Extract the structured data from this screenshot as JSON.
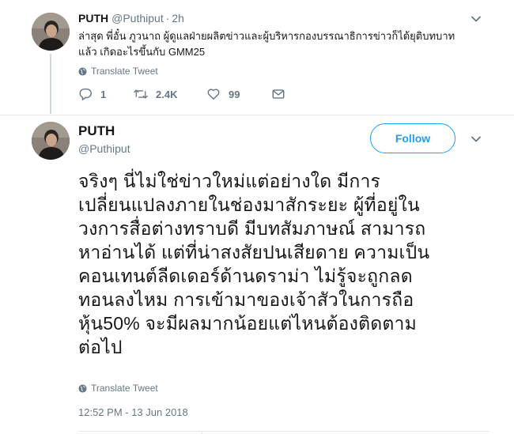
{
  "reply_tweet": {
    "name": "PUTH",
    "handle": "@Puthiput",
    "separator": "·",
    "time": "2h",
    "text_lines": [
      "ล่าสุด พี่อั๋น ภูวนาถ ผู้ดูแลฝ่ายผลิตข่าวและผู้บริหารกองบรรณาธิการข่าวก็ได้ยุติบทบาท",
      "แล้ว เกิดอะไรขึ้นกับ GMM25"
    ],
    "translate_label": "Translate Tweet",
    "reply_count": "1",
    "retweet_count": "2.4K",
    "like_count": "99"
  },
  "main_tweet": {
    "name": "PUTH",
    "handle": "@Puthiput",
    "follow_label": "Follow",
    "text_lines": [
      "จริงๆ นี่ไม่ใช่ข่าวใหม่แต่อย่างใด มีการ",
      "เปลี่ยนแปลงภายในช่องมาสักระยะ ผู้ที่อยู่ใน",
      "วงการสื่อต่างทราบดี มีบทสัมภาษณ์ สามารถ",
      "หาอ่านได้ แต่ที่น่าสงสัยปนเสียดาย ความเป็น",
      "คอนเทนต์ลีดเดอร์ด้านดราม่า ไม่รู้จะถูกลด",
      "ทอนลงไหม การเข้ามาของเจ้าสัวในการถือ",
      "หุ้น50% จะมีผลมากน้อยแต่ไหนต้องติดตาม",
      "ต่อไป"
    ],
    "translate_label": "Translate Tweet",
    "timestamp": "12:52 PM - 13 Jun 2018"
  },
  "icons": {
    "avatar": "avatar-photo",
    "chevron": "chevron-down-icon",
    "globe": "globe-icon",
    "reply": "reply-icon",
    "retweet": "retweet-icon",
    "like": "heart-icon",
    "dm": "envelope-icon"
  },
  "colors": {
    "accent": "#1da1f2",
    "text": "#14171a",
    "secondary": "#657786",
    "border": "#e6ecf0",
    "thread_line": "#cfd9de"
  }
}
